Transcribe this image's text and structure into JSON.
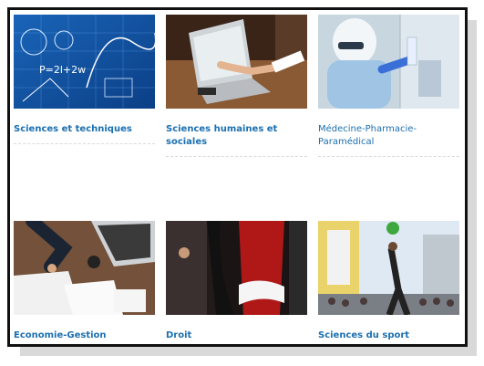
{
  "categories": [
    {
      "label": "Sciences et techniques",
      "image": "math-formulas-photo"
    },
    {
      "label": "Sciences humaines et sociales",
      "image": "handshake-laptop-photo"
    },
    {
      "label": "Médecine-Pharmacie-Paramédical",
      "image": "lab-researcher-photo"
    },
    {
      "label": "Economie-Gestion",
      "image": "business-desk-photo"
    },
    {
      "label": "Droit",
      "image": "magistrate-robe-photo"
    },
    {
      "label": "Sciences du sport",
      "image": "football-street-photo"
    }
  ],
  "image_text": {
    "formula": "P=2l+2w"
  },
  "colors": {
    "link": "#1b6fb0",
    "frame_border": "#111111",
    "shadow": "#d9d9d9"
  }
}
